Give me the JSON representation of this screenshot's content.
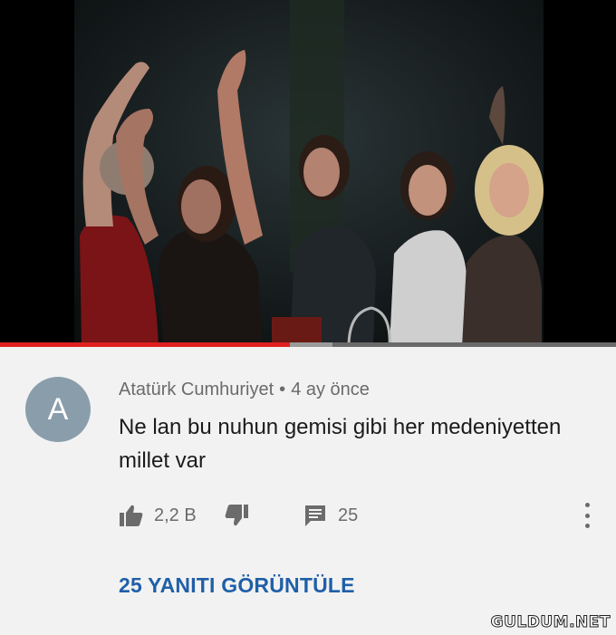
{
  "video": {
    "thumbnail_icon": "party-scene-image",
    "progress_played": 0.47,
    "progress_buffered": 0.54,
    "accent_color": "#e02020"
  },
  "comment": {
    "avatar_letter": "A",
    "avatar_color": "#8a9dab",
    "author": "Atatürk Cumhuriyet",
    "separator": "•",
    "time": "4 ay önce",
    "text": "Ne lan bu nuhun gemisi gibi her medeniyetten millet var",
    "likes": "2,2 B",
    "replies_count": "25",
    "view_replies_label": "25 YANITI GÖRÜNTÜLE",
    "link_color": "#1f5fa8"
  },
  "watermark": "GULDUM.NET"
}
